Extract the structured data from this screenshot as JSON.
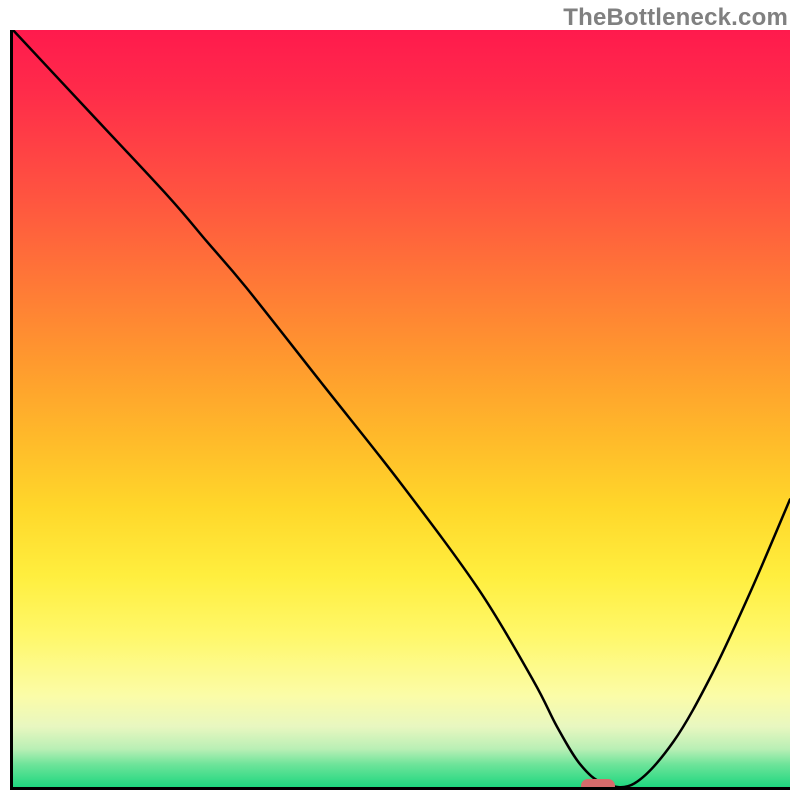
{
  "watermark": "TheBottleneck.com",
  "chart_data": {
    "type": "line",
    "title": "",
    "xlabel": "",
    "ylabel": "",
    "xlim": [
      0,
      100
    ],
    "ylim": [
      0,
      100
    ],
    "grid": false,
    "series": [
      {
        "name": "bottleneck-curve",
        "x": [
          0,
          10,
          20,
          25,
          30,
          40,
          50,
          60,
          67,
          70,
          73,
          76,
          80,
          85,
          90,
          95,
          100
        ],
        "y": [
          100,
          89,
          78,
          72,
          66,
          53,
          40,
          26,
          14,
          8,
          3,
          0.5,
          0.5,
          6,
          15,
          26,
          38
        ]
      }
    ],
    "annotations": [
      {
        "name": "optimal-marker",
        "x": 75,
        "y": 0.5,
        "color": "#d66b6b"
      }
    ],
    "background_gradient": {
      "stops": [
        {
          "pos": 0,
          "color": "#ff1a4d"
        },
        {
          "pos": 22,
          "color": "#ff5440"
        },
        {
          "pos": 44,
          "color": "#ff9a2e"
        },
        {
          "pos": 63,
          "color": "#ffd72a"
        },
        {
          "pos": 80,
          "color": "#fff86a"
        },
        {
          "pos": 92,
          "color": "#e8f7c0"
        },
        {
          "pos": 100,
          "color": "#1fd77f"
        }
      ]
    }
  }
}
